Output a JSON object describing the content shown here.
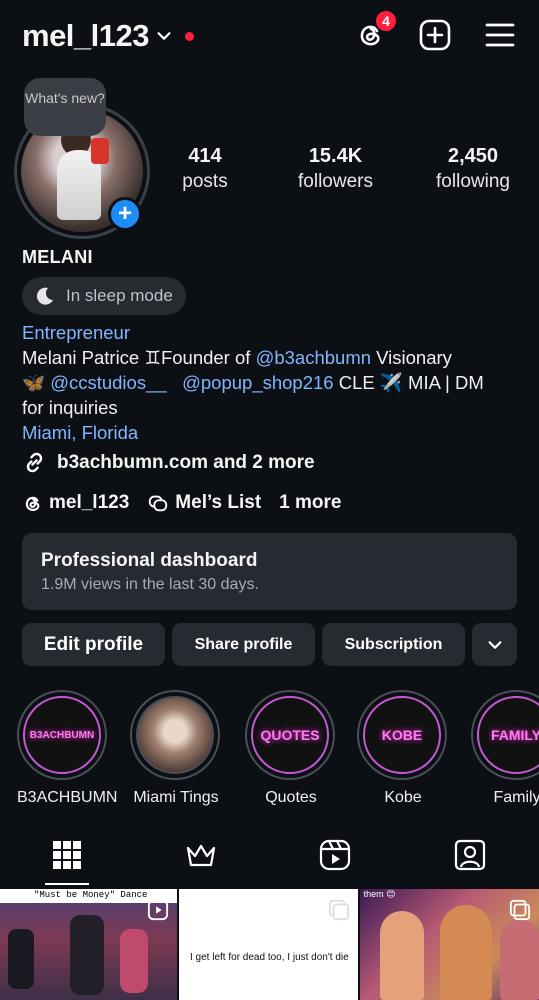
{
  "header": {
    "username": "mel_l123",
    "notification_count": "4"
  },
  "profile": {
    "note": "What's new?",
    "stats": [
      {
        "value": "414",
        "label": "posts"
      },
      {
        "value": "15.4K",
        "label": "followers"
      },
      {
        "value": "2,450",
        "label": "following"
      }
    ],
    "name": "MELANI",
    "status": "In sleep mode",
    "bio": {
      "category": "Entrepreneur",
      "line1_prefix": "Melani Patrice ♊Founder of ",
      "line1_mention": "@b3achbumn",
      "line1_suffix": " Visionary",
      "line2_emoji": "🦋 ",
      "line2_mention1": "@ccstudios__",
      "line2_mention2": "@popup_shop216",
      "line2_suffix": " CLE ✈️ MIA | DM",
      "line3": "for inquiries",
      "location": "Miami, Florida"
    },
    "link": "b3achbumn.com and 2 more",
    "threads_handle": "mel_l123",
    "list_label": "Mel’s List",
    "more_label": "1 more"
  },
  "dashboard": {
    "title": "Professional dashboard",
    "subtitle": "1.9M views in the last 30 days."
  },
  "actions": {
    "edit": "Edit profile",
    "share": "Share profile",
    "subscription": "Subscription"
  },
  "highlights": [
    {
      "label": "B3ACHBUMN",
      "cover_text": "B3ACHBUMN"
    },
    {
      "label": "Miami Tings",
      "cover_text": ""
    },
    {
      "label": "Quotes",
      "cover_text": "QUOTES"
    },
    {
      "label": "Kobe",
      "cover_text": "KOBE"
    },
    {
      "label": "Family",
      "cover_text": "FAMILY"
    }
  ],
  "grid": {
    "post1_caption": "\"Must be Money\" Dance",
    "post2_caption": "I get left for dead too, I just don't die",
    "post3_caption": "them 😊"
  },
  "colors": {
    "background": "#0c0f14",
    "accent_blue": "#1d8cf8",
    "link_blue": "#82b6ff",
    "badge_red": "#ff1f3d",
    "neon_pink": "#ff7cf2"
  }
}
